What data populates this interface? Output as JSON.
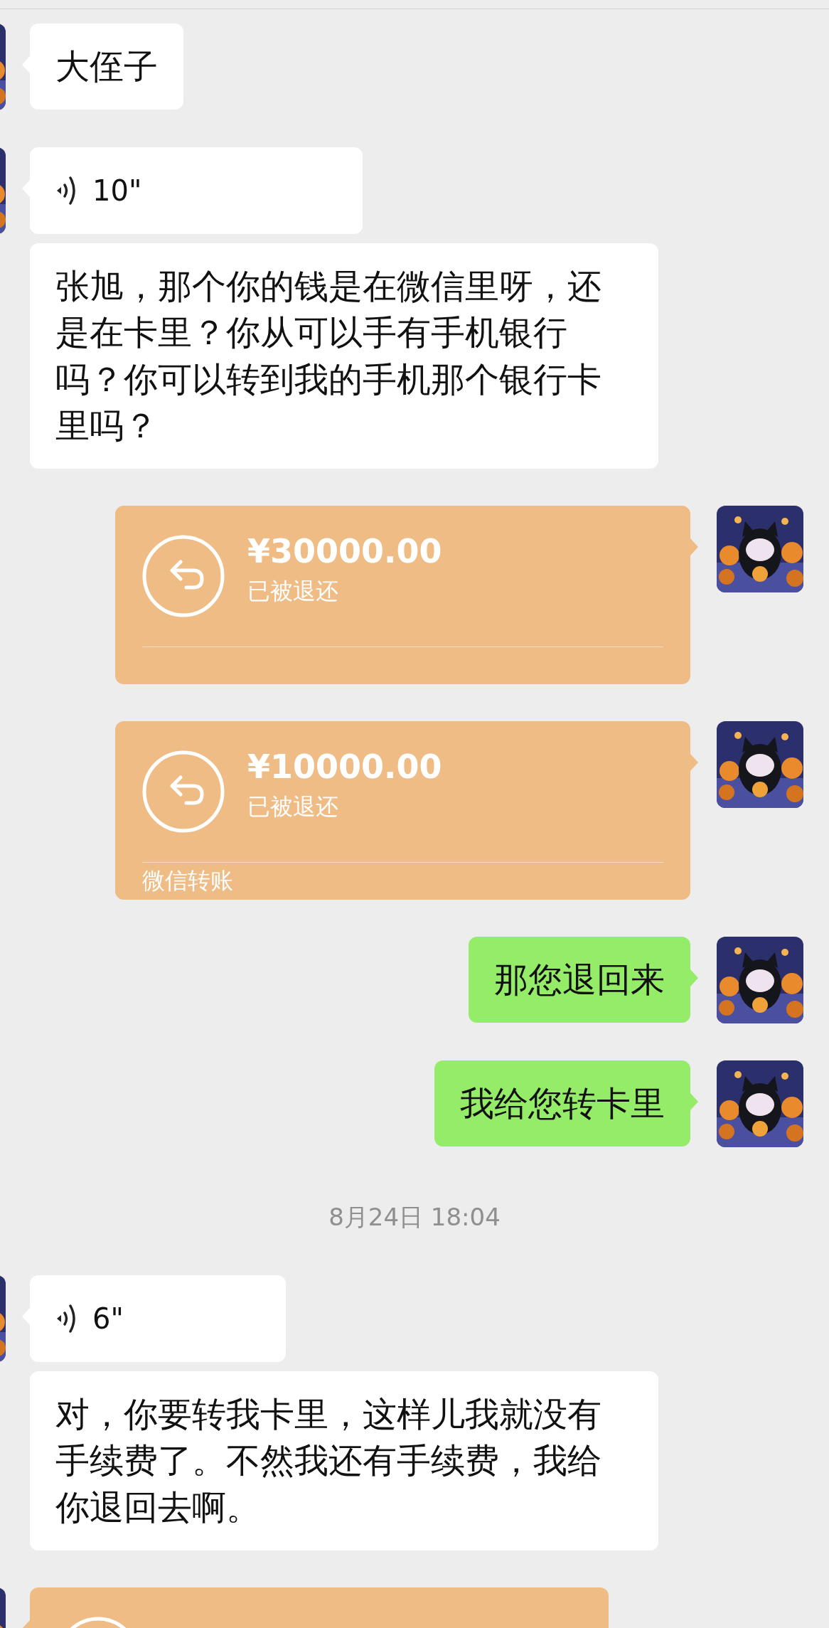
{
  "messages": [
    {
      "kind": "text",
      "outgoing": false,
      "avatar": true,
      "text": "大侄子"
    },
    {
      "kind": "voice",
      "outgoing": false,
      "avatar": true,
      "duration": "10\""
    },
    {
      "kind": "text",
      "outgoing": false,
      "avatar": false,
      "text": "张旭，那个你的钱是在微信里呀，还是在卡里？你从可以手有手机银行吗？你可以转到我的手机那个银行卡里吗？"
    },
    {
      "kind": "transfer",
      "outgoing": true,
      "avatar": true,
      "amount": "¥30000.00",
      "status": "已被退还"
    },
    {
      "kind": "transfer",
      "outgoing": true,
      "avatar": true,
      "amount": "¥10000.00",
      "status": "已被退还",
      "footer": "微信转账"
    },
    {
      "kind": "text",
      "outgoing": true,
      "avatar": true,
      "text": "那您退回来"
    },
    {
      "kind": "text",
      "outgoing": true,
      "avatar": true,
      "text": "我给您转卡里"
    },
    {
      "kind": "timestamp",
      "text": "8月24日 18:04"
    },
    {
      "kind": "voice",
      "outgoing": false,
      "avatar": true,
      "duration": "6\""
    },
    {
      "kind": "text",
      "outgoing": false,
      "avatar": false,
      "text": "对，你要转我卡里，这样儿我就没有手续费了。不然我还有手续费，我给你退回去啊。"
    },
    {
      "kind": "transfer",
      "outgoing": false,
      "avatar": true
    }
  ]
}
